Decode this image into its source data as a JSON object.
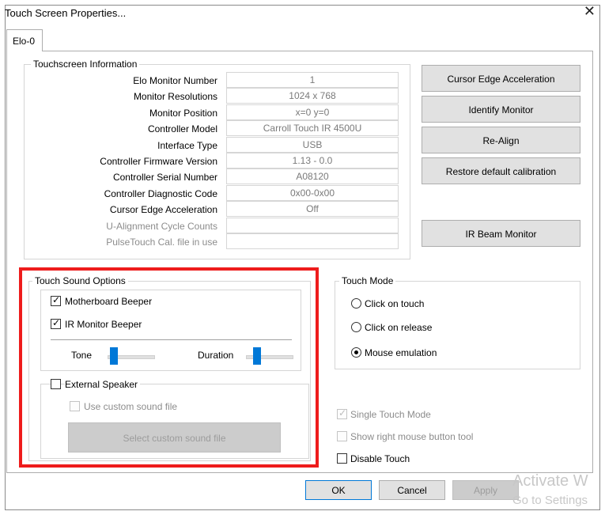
{
  "window": {
    "title": "Touch Screen Properties...",
    "close_glyph": "✕"
  },
  "tab": {
    "label": "Elo-0"
  },
  "info": {
    "group_label": "Touchscreen Information",
    "rows": [
      {
        "label": "Elo Monitor Number",
        "value": "1"
      },
      {
        "label": "Monitor Resolutions",
        "value": "1024 x 768"
      },
      {
        "label": "Monitor Position",
        "value": "x=0 y=0"
      },
      {
        "label": "Controller Model",
        "value": "Carroll Touch IR 4500U"
      },
      {
        "label": "Interface Type",
        "value": "USB"
      },
      {
        "label": "Controller Firmware Version",
        "value": "1.13 - 0.0"
      },
      {
        "label": "Controller Serial Number",
        "value": "A08120"
      },
      {
        "label": "Controller Diagnostic Code",
        "value": "0x00-0x00"
      },
      {
        "label": "Cursor Edge Acceleration",
        "value": "Off"
      },
      {
        "label": "U-Alignment Cycle Counts",
        "value": ""
      },
      {
        "label": "PulseTouch Cal. file in use",
        "value": ""
      }
    ]
  },
  "side_buttons": {
    "cursor_edge": "Cursor Edge Acceleration",
    "identify": "Identify Monitor",
    "realign": "Re-Align",
    "restore": "Restore default calibration",
    "ir_beam": "IR Beam Monitor"
  },
  "sound": {
    "group_label": "Touch Sound Options",
    "motherboard_beeper": "Motherboard Beeper",
    "ir_monitor_beeper": "IR Monitor Beeper",
    "tone": "Tone",
    "duration": "Duration",
    "external_speaker": "External Speaker",
    "use_custom": "Use custom sound file",
    "select_custom": "Select custom sound file"
  },
  "mode": {
    "group_label": "Touch Mode",
    "click_on_touch": "Click on touch",
    "click_on_release": "Click on release",
    "mouse_emulation": "Mouse emulation",
    "selected": "Mouse emulation"
  },
  "options": {
    "single_touch": "Single Touch Mode",
    "show_right": "Show right mouse button tool",
    "disable_touch": "Disable Touch"
  },
  "footer": {
    "ok": "OK",
    "cancel": "Cancel",
    "apply": "Apply"
  },
  "watermark": {
    "line1": "Activate W",
    "line2": "Go to Settings"
  },
  "colors": {
    "accent": "#0078d7",
    "highlight_box": "#ee1c1c"
  }
}
